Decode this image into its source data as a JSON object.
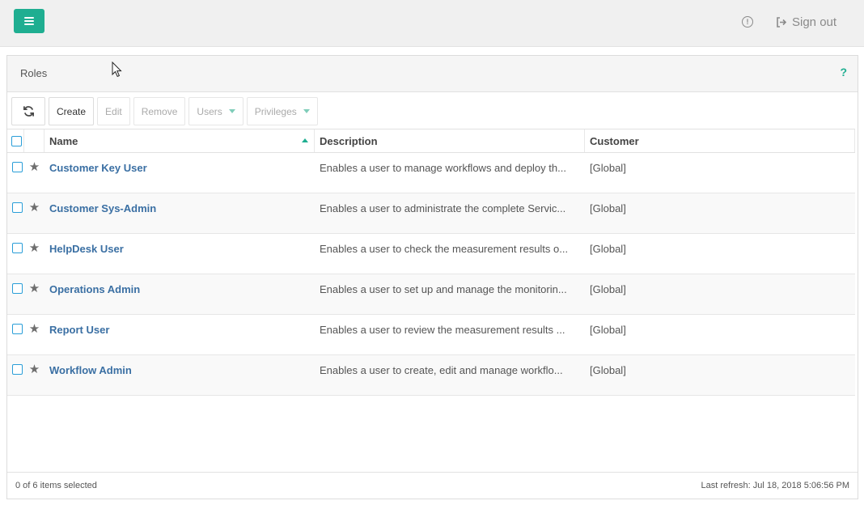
{
  "topbar": {
    "menu_icon": "hamburger-icon",
    "info_icon": "info-circle-icon",
    "signout_label": "Sign out",
    "signout_icon": "sign-out-icon",
    "accent_color": "#1fae91"
  },
  "panel": {
    "title": "Roles",
    "help_label": "?"
  },
  "toolbar": {
    "refresh_icon": "refresh-icon",
    "create_label": "Create",
    "edit_label": "Edit",
    "remove_label": "Remove",
    "users_label": "Users",
    "privileges_label": "Privileges"
  },
  "table": {
    "columns": {
      "name": "Name",
      "description": "Description",
      "customer": "Customer"
    },
    "sort": {
      "column": "Name",
      "direction": "ascending"
    },
    "rows": [
      {
        "name": "Customer Key User",
        "description": "Enables a user to manage workflows and deploy th...",
        "customer": "[Global]"
      },
      {
        "name": "Customer Sys-Admin",
        "description": "Enables a user to administrate the complete Servic...",
        "customer": "[Global]"
      },
      {
        "name": "HelpDesk User",
        "description": "Enables a user to check the measurement results o...",
        "customer": "[Global]"
      },
      {
        "name": "Operations Admin",
        "description": "Enables a user to set up and manage the monitorin...",
        "customer": "[Global]"
      },
      {
        "name": "Report User",
        "description": "Enables a user to review the measurement results ...",
        "customer": "[Global]"
      },
      {
        "name": "Workflow Admin",
        "description": "Enables a user to create, edit and manage workflo...",
        "customer": "[Global]"
      }
    ]
  },
  "footer": {
    "selection": "0 of 6 items selected",
    "last_refresh": "Last refresh: Jul 18, 2018 5:06:56 PM"
  }
}
